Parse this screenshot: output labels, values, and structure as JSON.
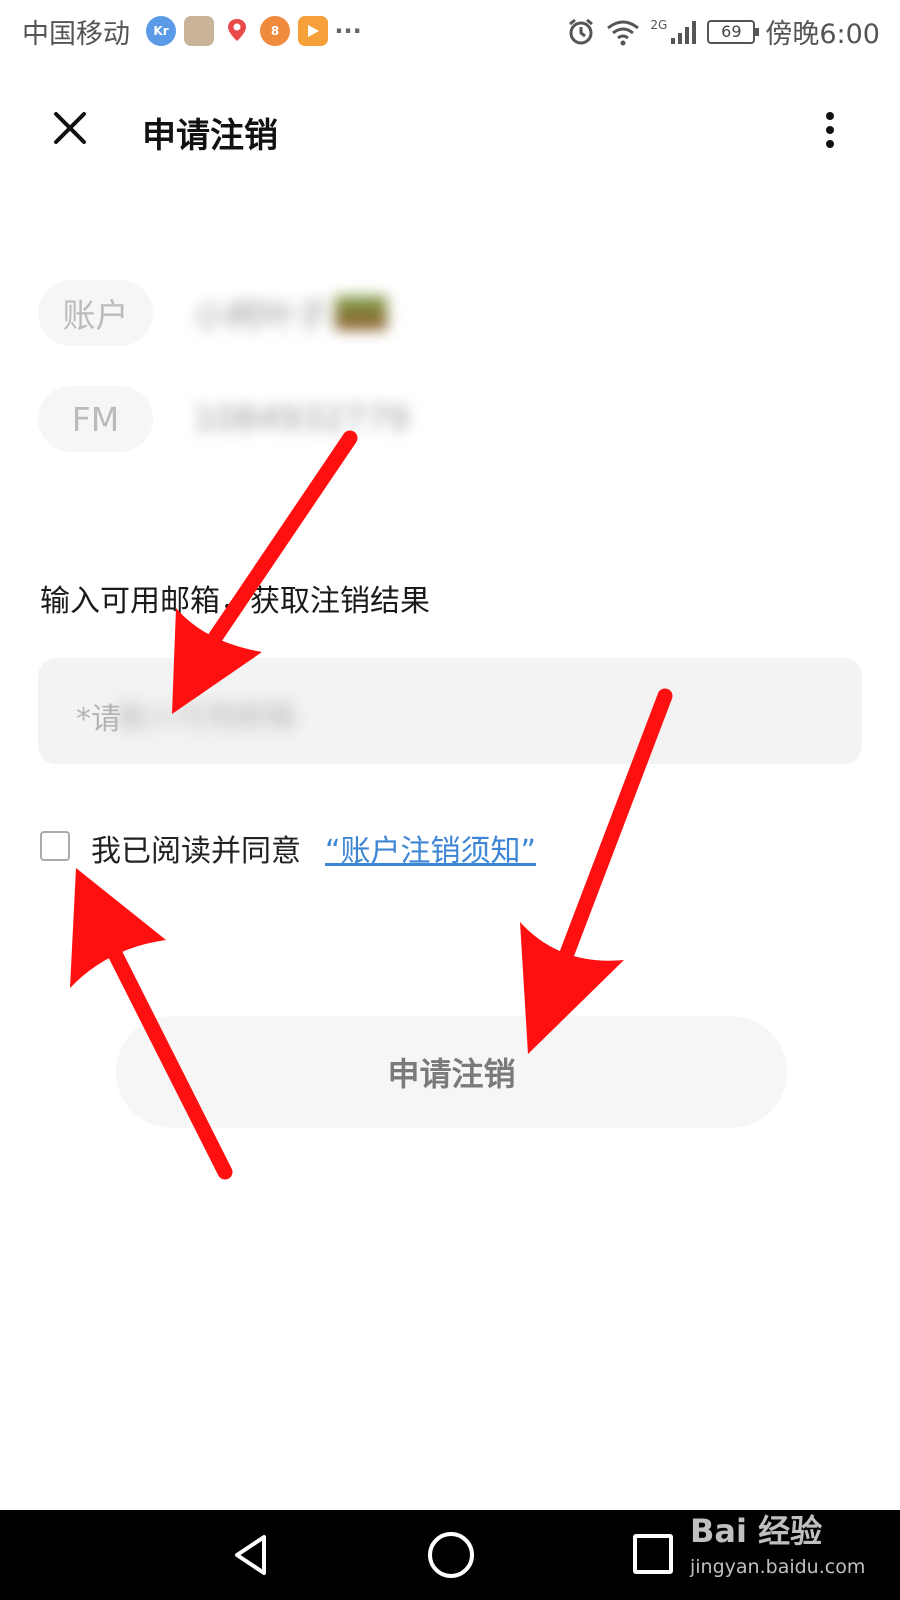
{
  "status_bar": {
    "carrier": "中国移动",
    "notification_icons": [
      "36kr-icon",
      "photo-app-icon",
      "map-app-icon",
      "kuaishou-icon",
      "video-app-icon"
    ],
    "more": "···",
    "network": "2G",
    "battery": "69",
    "time": "傍晚6:00"
  },
  "header": {
    "title": "申请注销"
  },
  "account": {
    "account_label": "账户",
    "account_value": "小柯叶子",
    "fm_label": "FM",
    "fm_value": "1084932779"
  },
  "email": {
    "hint": "输入可用邮箱，获取注销结果",
    "placeholder_visible": "*请",
    "placeholder_blurred": "输入可用邮箱"
  },
  "agreement": {
    "text": "我已阅读并同意",
    "link": "“账户注销须知”",
    "checked": false
  },
  "submit": {
    "label": "申请注销"
  },
  "watermark": {
    "brand": "Bai 经验",
    "domain": "jingyan.baidu.com"
  },
  "colors": {
    "annotation_arrow": "#ff1010",
    "link": "#3d86d6",
    "pill_bg": "#f6f6f6",
    "input_bg": "#f3f3f3"
  }
}
